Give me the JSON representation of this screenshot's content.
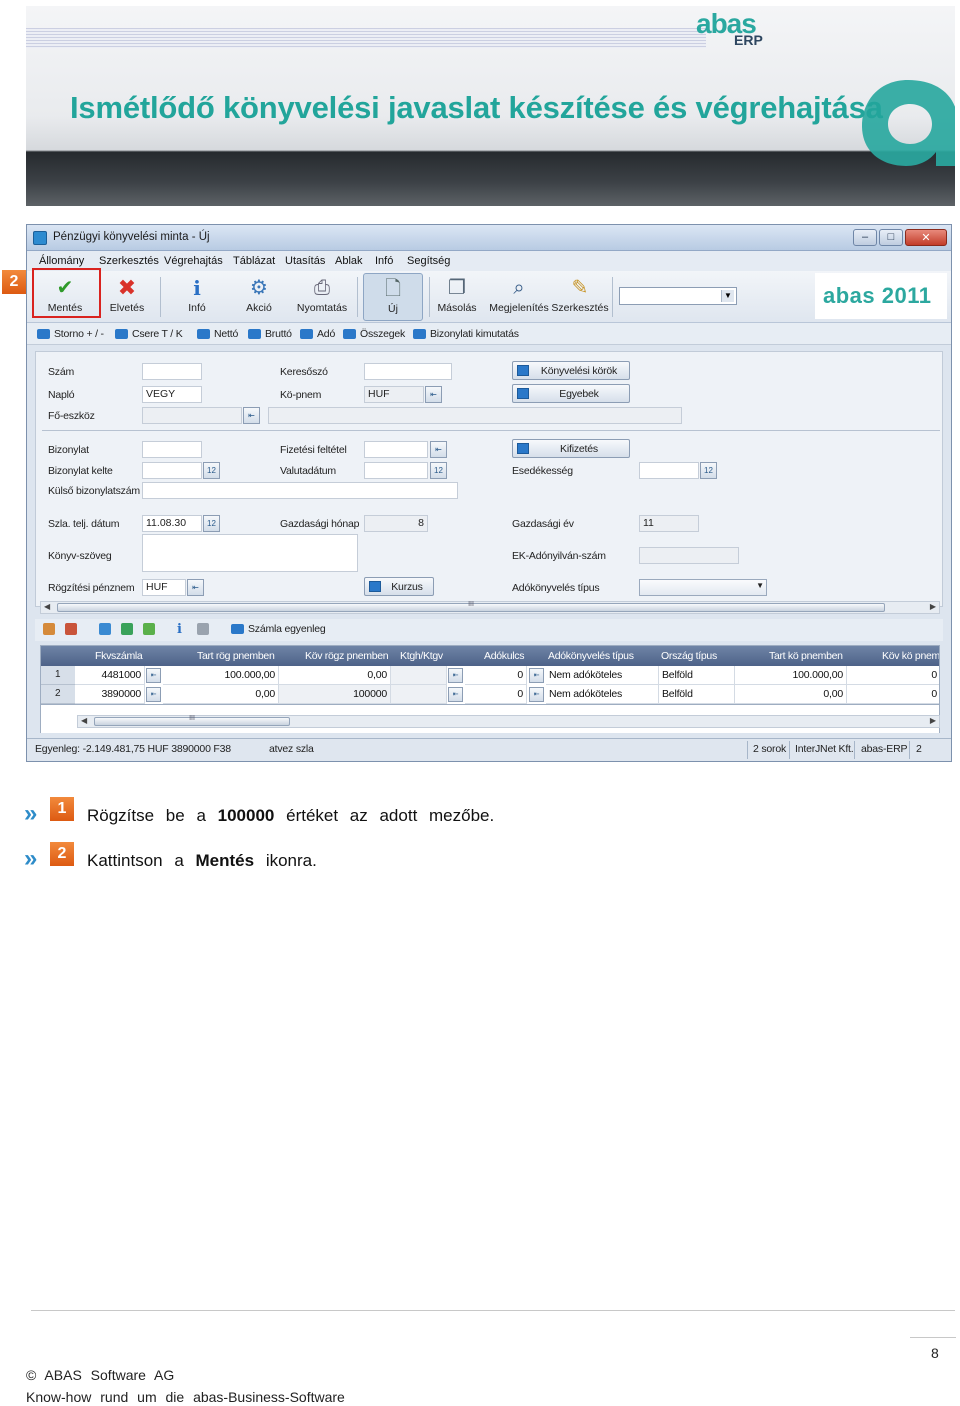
{
  "banner": {
    "title": "Ismétlődő könyvelési javaslat készítése és végrehajtása",
    "logo_word": "abas",
    "logo_sub": "ERP",
    "accent": "#22a59b"
  },
  "window": {
    "title": "Pénzügyi könyvelési minta - Új",
    "menu": [
      "Állomány",
      "Szerkesztés",
      "Végrehajtás",
      "Táblázat",
      "Utasítás",
      "Ablak",
      "Infó",
      "Segítség"
    ],
    "toolbar": {
      "mentes": "Mentés",
      "elvetes": "Elvetés",
      "info": "Infó",
      "akcio": "Akció",
      "nyomtatas": "Nyomtatás",
      "uj": "Új",
      "masolas": "Másolás",
      "megjelenites": "Megjelenítés",
      "szerkesztes": "Szerkesztés",
      "brand": "abas 2011"
    },
    "subtoolbar": [
      "Storno + / -",
      "Csere T / K",
      "Nettó",
      "Bruttó",
      "Adó",
      "Összegek",
      "Bizonylati kimutatás"
    ],
    "form": {
      "szam": {
        "label": "Szám",
        "value": ""
      },
      "naplo": {
        "label": "Napló",
        "value": "VEGY"
      },
      "foeszkoz": {
        "label": "Fő-eszköz",
        "value": ""
      },
      "keresoszo": {
        "label": "Keresőszó",
        "value": ""
      },
      "konem": {
        "label": "Kö-pnem",
        "value": "HUF"
      },
      "btn_konyvelesi_korok": "Könyvelési körök",
      "btn_egyebek": "Egyebek",
      "bizonylat": {
        "label": "Bizonylat",
        "value": ""
      },
      "bizonylat_kelte": {
        "label": "Bizonylat kelte",
        "value": ""
      },
      "kulso_bizonylatszam": {
        "label": "Külső bizonylatszám",
        "value": ""
      },
      "fizetesi_feltetel": {
        "label": "Fizetési feltétel",
        "value": ""
      },
      "valutadatum": {
        "label": "Valutadátum",
        "value": ""
      },
      "btn_kifizetes": "Kifizetés",
      "esedekesseg": {
        "label": "Esedékesség",
        "value": ""
      },
      "szla_telj_datum": {
        "label": "Szla. telj. dátum",
        "value": "11.08.30"
      },
      "gazdasagi_honap": {
        "label": "Gazdasági hónap",
        "value": "8"
      },
      "gazdasagi_ev": {
        "label": "Gazdasági év",
        "value": "11"
      },
      "konyv_szoveg": {
        "label": "Könyv-szöveg",
        "value": ""
      },
      "ek_adonyilvan_szam": {
        "label": "EK-Adónyilván-szám",
        "value": ""
      },
      "rogzitesi_penznem": {
        "label": "Rögzítési pénznem",
        "value": "HUF"
      },
      "btn_kurzus": "Kurzus",
      "adokonyveles_tipus": {
        "label": "Adókönyvelés típus",
        "value": ""
      }
    },
    "table_toolbar_label": "Számla egyenleg",
    "table": {
      "columns": [
        "Fkvszámla",
        "Tart rög pnemben",
        "Köv rögz pnemben",
        "Ktgh/Ktgv",
        "Adókulcs",
        "Adókönyvelés típus",
        "Ország típus",
        "Tart kö pnemben",
        "Köv kö pnem"
      ],
      "rows": [
        {
          "n": "1",
          "fkv": "4481000",
          "tart": "100.000,00",
          "kov": "0,00",
          "ktgh": "",
          "ado": "0",
          "tipus": "Nem adóköteles",
          "orszag": "Belföld",
          "tartko": "100.000,00",
          "kovko": "0"
        },
        {
          "n": "2",
          "fkv": "3890000",
          "tart": "0,00",
          "kov": "100000",
          "ktgh": "",
          "ado": "0",
          "tipus": "Nem adóköteles",
          "orszag": "Belföld",
          "tartko": "0,00",
          "kovko": "0"
        }
      ]
    },
    "status": {
      "egyenleg": "Egyenleg: -2.149.481,75 HUF  3890000 F38",
      "atvez": "atvez szla",
      "sorok": "2 sorok",
      "company": "InterJNet Kft.",
      "app": "abas-ERP",
      "num": "2"
    }
  },
  "badges": {
    "one": "1",
    "two": "2"
  },
  "instructions": {
    "step1_pre": "Rögzítse be a",
    "step1_bold": "100000",
    "step1_post": "értéket az adott mezőbe.",
    "step2_pre": "Kattintson a",
    "step2_bold": "Mentés",
    "step2_post": "ikonra."
  },
  "footer": {
    "copyright": "©  ABAS Software AG",
    "tagline": "Know-how rund um die abas-Business-Software",
    "page": "8"
  }
}
